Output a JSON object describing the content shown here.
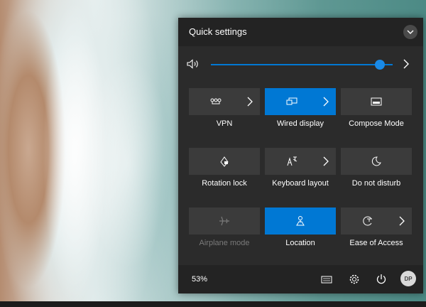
{
  "panel": {
    "title": "Quick settings",
    "volume_level": 0.93
  },
  "tiles": [
    {
      "label": "VPN",
      "icon": "vpn-icon",
      "active": false,
      "has_chevron": true
    },
    {
      "label": "Wired display",
      "icon": "wired-display-icon",
      "active": true,
      "has_chevron": true
    },
    {
      "label": "Compose Mode",
      "icon": "compose-mode-icon",
      "active": false,
      "has_chevron": false
    },
    {
      "label": "Rotation lock",
      "icon": "rotation-lock-icon",
      "active": false,
      "has_chevron": false
    },
    {
      "label": "Keyboard layout",
      "icon": "keyboard-layout-icon",
      "active": false,
      "has_chevron": true
    },
    {
      "label": "Do not disturb",
      "icon": "moon-icon",
      "active": false,
      "has_chevron": false
    },
    {
      "label": "Airplane mode",
      "icon": "airplane-icon",
      "active": false,
      "disabled": true,
      "has_chevron": false
    },
    {
      "label": "Location",
      "icon": "location-icon",
      "active": true,
      "has_chevron": false
    },
    {
      "label": "Ease of Access",
      "icon": "ease-of-access-icon",
      "active": false,
      "has_chevron": true
    }
  ],
  "footer": {
    "battery": "53%",
    "avatar_initials": "DP",
    "icons": [
      "keyboard-icon",
      "gear-icon",
      "power-icon"
    ]
  },
  "colors": {
    "accent": "#0078d4",
    "panel_bg": "#2b2b2b",
    "tile_bg": "#3b3b3b"
  }
}
